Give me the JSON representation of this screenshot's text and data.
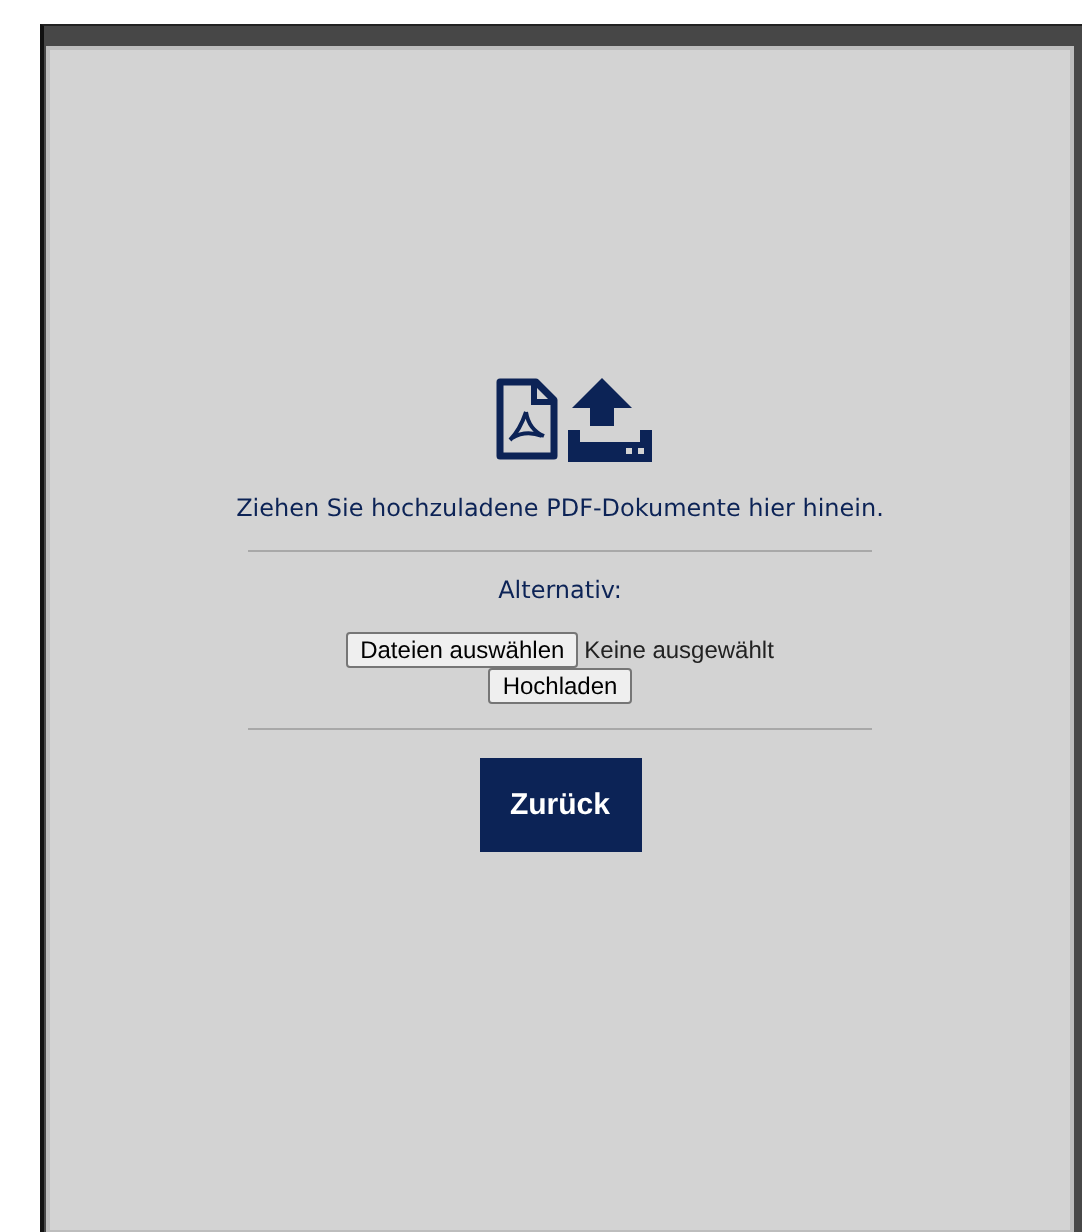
{
  "dialog": {
    "drop_hint": "Ziehen Sie hochzuladene PDF-Dokumente hier hinein.",
    "alternative_label": "Alternativ:",
    "file_button": "Dateien auswählen",
    "file_status": "Keine ausgewählt",
    "upload_button": "Hochladen",
    "back_button": "Zurück"
  }
}
